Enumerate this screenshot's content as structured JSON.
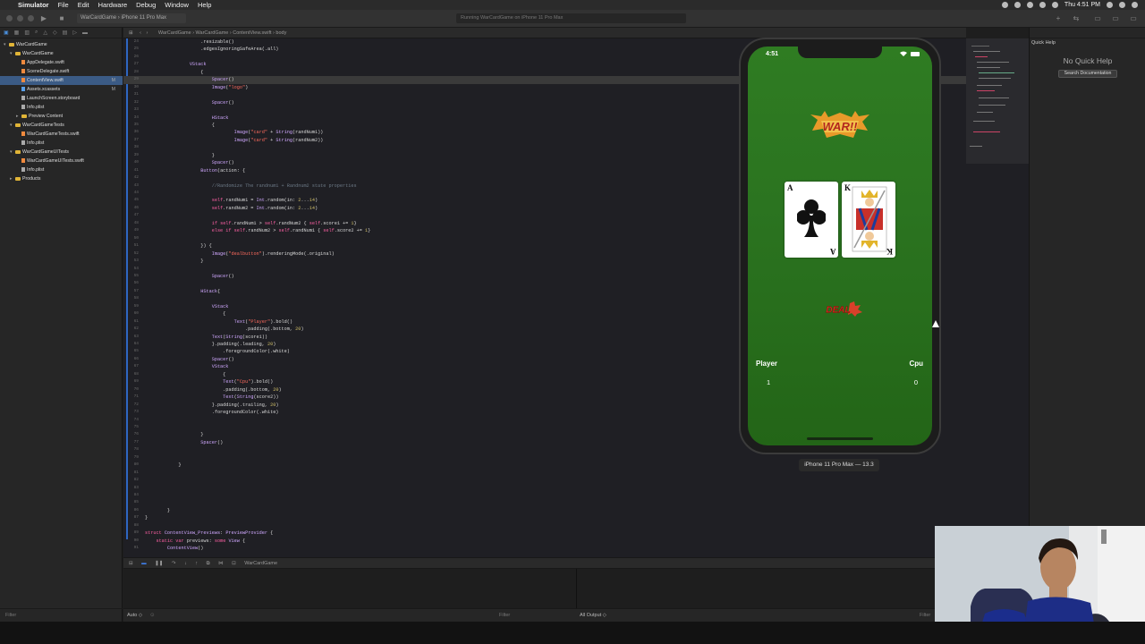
{
  "menubar": {
    "app": "Simulator",
    "items": [
      "File",
      "Edit",
      "Hardware",
      "Debug",
      "Window",
      "Help"
    ],
    "clock": "Thu 4:51 PM"
  },
  "toolbar": {
    "scheme": "WarCardGame  ›  iPhone 11 Pro Max",
    "activity": "Running WarCardGame on iPhone 11 Pro Max"
  },
  "navigator": {
    "items": [
      {
        "label": "WarCardGame",
        "kind": "project",
        "indent": 0,
        "chev": "▾"
      },
      {
        "label": "WarCardGame",
        "kind": "folder",
        "indent": 1,
        "chev": "▾"
      },
      {
        "label": "AppDelegate.swift",
        "kind": "swift",
        "indent": 2
      },
      {
        "label": "SceneDelegate.swift",
        "kind": "swift",
        "indent": 2
      },
      {
        "label": "ContentView.swift",
        "kind": "swift",
        "indent": 2,
        "selected": true,
        "badge": "M"
      },
      {
        "label": "Assets.xcassets",
        "kind": "assets",
        "indent": 2,
        "badge": "M"
      },
      {
        "label": "LaunchScreen.storyboard",
        "kind": "other",
        "indent": 2
      },
      {
        "label": "Info.plist",
        "kind": "other",
        "indent": 2
      },
      {
        "label": "Preview Content",
        "kind": "folder",
        "indent": 2,
        "chev": "▸"
      },
      {
        "label": "WarCardGameTests",
        "kind": "folder",
        "indent": 1,
        "chev": "▾"
      },
      {
        "label": "WarCardGameTests.swift",
        "kind": "swift",
        "indent": 2
      },
      {
        "label": "Info.plist",
        "kind": "other",
        "indent": 2
      },
      {
        "label": "WarCardGameUITests",
        "kind": "folder",
        "indent": 1,
        "chev": "▾"
      },
      {
        "label": "WarCardGameUITests.swift",
        "kind": "swift",
        "indent": 2
      },
      {
        "label": "Info.plist",
        "kind": "other",
        "indent": 2
      },
      {
        "label": "Products",
        "kind": "folder",
        "indent": 1,
        "chev": "▸"
      }
    ],
    "filter": "Filter"
  },
  "editor": {
    "jumpbar": "WarCardGame  ›  WarCardGame  ›  ContentView.swift  ›  body",
    "lines": [
      {
        "n": "24",
        "t": "                    .resizable()"
      },
      {
        "n": "25",
        "t": "                    .edgesIgnoringSafeArea(.all)"
      },
      {
        "n": "26",
        "t": ""
      },
      {
        "n": "27",
        "t": "                VStack"
      },
      {
        "n": "28",
        "t": "                    {"
      },
      {
        "n": "29",
        "t": "                        Spacer()",
        "hl": true
      },
      {
        "n": "30",
        "t": "                        Image(\"logo\")"
      },
      {
        "n": "31",
        "t": ""
      },
      {
        "n": "32",
        "t": "                        Spacer()"
      },
      {
        "n": "33",
        "t": ""
      },
      {
        "n": "34",
        "t": "                        HStack"
      },
      {
        "n": "35",
        "t": "                        {"
      },
      {
        "n": "36",
        "t": "                                Image(\"card\" + String(randNum1))"
      },
      {
        "n": "37",
        "t": "                                Image(\"card\" + String(randNum2))"
      },
      {
        "n": "38",
        "t": ""
      },
      {
        "n": "39",
        "t": "                        }"
      },
      {
        "n": "40",
        "t": "                        Spacer()"
      },
      {
        "n": "41",
        "t": "                    Button(action: {"
      },
      {
        "n": "42",
        "t": ""
      },
      {
        "n": "43",
        "t": "                        //Randomize The randnum1 + Randnum2 state properties"
      },
      {
        "n": "44",
        "t": ""
      },
      {
        "n": "45",
        "t": "                        self.randNum1 = Int.random(in: 2...14)"
      },
      {
        "n": "46",
        "t": "                        self.randNum2 = Int.random(in: 2...14)"
      },
      {
        "n": "47",
        "t": ""
      },
      {
        "n": "48",
        "t": "                        if self.randNum1 > self.randNum2 { self.score1 += 1}"
      },
      {
        "n": "49",
        "t": "                        else if self.randNum2 > self.randNum1 { self.score2 += 1}"
      },
      {
        "n": "50",
        "t": ""
      },
      {
        "n": "51",
        "t": "                    }) {"
      },
      {
        "n": "52",
        "t": "                        Image(\"dealbutton\").renderingMode(.original)"
      },
      {
        "n": "53",
        "t": "                    }"
      },
      {
        "n": "54",
        "t": ""
      },
      {
        "n": "55",
        "t": "                        Spacer()"
      },
      {
        "n": "56",
        "t": ""
      },
      {
        "n": "57",
        "t": "                    HStack{"
      },
      {
        "n": "58",
        "t": ""
      },
      {
        "n": "59",
        "t": "                        VStack"
      },
      {
        "n": "60",
        "t": "                            {"
      },
      {
        "n": "61",
        "t": "                                Text(\"Player\").bold()"
      },
      {
        "n": "62",
        "t": "                                    .padding(.bottom, 20)"
      },
      {
        "n": "63",
        "t": "                        Text(String(score1))"
      },
      {
        "n": "64",
        "t": "                        }.padding(.leading, 20)"
      },
      {
        "n": "65",
        "t": "                            .foregroundColor(.white)"
      },
      {
        "n": "66",
        "t": "                        Spacer()"
      },
      {
        "n": "67",
        "t": "                        VStack"
      },
      {
        "n": "68",
        "t": "                            {"
      },
      {
        "n": "69",
        "t": "                            Text(\"Cpu\").bold()"
      },
      {
        "n": "70",
        "t": "                            .padding(.bottom, 20)"
      },
      {
        "n": "71",
        "t": "                            Text(String(score2))"
      },
      {
        "n": "72",
        "t": "                        }.padding(.trailing, 20)"
      },
      {
        "n": "73",
        "t": "                        .foregroundColor(.white)"
      },
      {
        "n": "74",
        "t": ""
      },
      {
        "n": "75",
        "t": ""
      },
      {
        "n": "76",
        "t": "                    }"
      },
      {
        "n": "77",
        "t": "                    Spacer()"
      },
      {
        "n": "78",
        "t": ""
      },
      {
        "n": "79",
        "t": ""
      },
      {
        "n": "80",
        "t": "            }"
      },
      {
        "n": "81",
        "t": ""
      },
      {
        "n": "82",
        "t": ""
      },
      {
        "n": "83",
        "t": ""
      },
      {
        "n": "84",
        "t": ""
      },
      {
        "n": "85",
        "t": ""
      },
      {
        "n": "86",
        "t": "        }"
      },
      {
        "n": "87",
        "t": "}"
      },
      {
        "n": "88",
        "t": ""
      },
      {
        "n": "89",
        "t": "struct ContentView_Previews: PreviewProvider {"
      },
      {
        "n": "90",
        "t": "    static var previews: some View {"
      },
      {
        "n": "91",
        "t": "        ContentView()"
      }
    ],
    "debug_target": "WarCardGame",
    "bottom": {
      "auto": "Auto ◇",
      "filter": "Filter",
      "output": "All Output ◇",
      "filter2": "Filter"
    }
  },
  "inspector": {
    "title": "Quick Help",
    "empty": "No Quick Help",
    "button": "Search Documentation"
  },
  "simulator": {
    "time": "4:51",
    "logo_text": "WAR!!",
    "card1_rank": "A",
    "card2_rank": "K",
    "deal_text": "DEAL",
    "player_label": "Player",
    "cpu_label": "Cpu",
    "player_score": "1",
    "cpu_score": "0",
    "device_label": "iPhone 11 Pro Max — 13.3"
  }
}
